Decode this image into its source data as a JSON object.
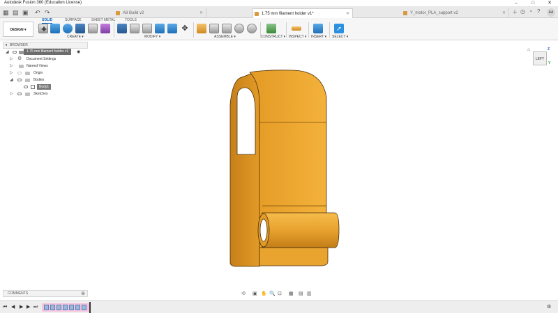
{
  "window": {
    "title": "Autodesk Fusion 360 (Education License)"
  },
  "tabs": [
    {
      "label": "A8 Build v2",
      "active": false
    },
    {
      "label": "1.75 mm filament holder v1*",
      "active": true
    },
    {
      "label": "Y_motor_PLA_support v2",
      "active": false
    }
  ],
  "user": {
    "initials": "AA"
  },
  "ribbon": {
    "workspace": "DESIGN ▾",
    "tabs": [
      "SOLID",
      "SURFACE",
      "SHEET METAL",
      "TOOLS"
    ],
    "groups": [
      "CREATE ▾",
      "MODIFY ▾",
      "ASSEMBLE ▾",
      "CONSTRUCT ▾",
      "INSPECT ▾",
      "INSERT ▾",
      "SELECT ▾"
    ]
  },
  "browser": {
    "title": "BROWSER",
    "root": "1.75 mm filament holder v1",
    "items": [
      "Document Settings",
      "Named Views",
      "Origin",
      "Bodies",
      "Body1",
      "Sketches"
    ]
  },
  "viewcube": {
    "face": "LEFT",
    "axis_z": "Z",
    "axis_y": "Y"
  },
  "comments": {
    "title": "COMMENTS"
  },
  "colors": {
    "model": "#f0aa2e",
    "accent": "#0b66c3"
  }
}
